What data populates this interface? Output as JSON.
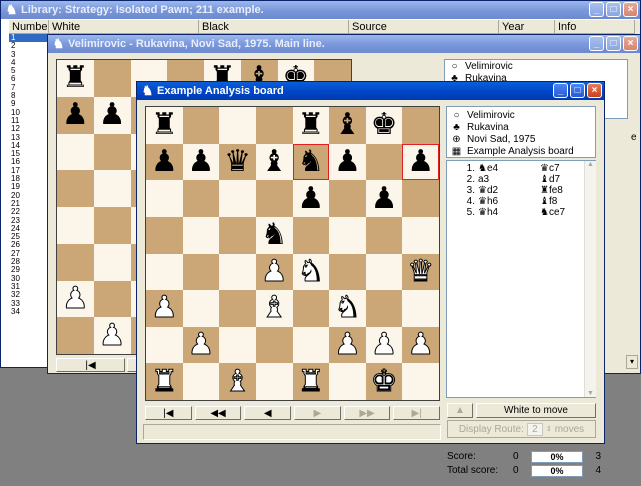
{
  "library": {
    "title": "Library: Strategy: Isolated Pawn; 211 example.",
    "columns": [
      "Number",
      "White",
      "Black",
      "Source",
      "Year",
      "Info"
    ],
    "row_numbers": [
      "1",
      "2",
      "3",
      "4",
      "5",
      "6",
      "7",
      "8",
      "9",
      "10",
      "11",
      "12",
      "13",
      "14",
      "15",
      "16",
      "17",
      "18",
      "19",
      "20",
      "21",
      "22",
      "23",
      "24",
      "25",
      "26",
      "27",
      "28",
      "29",
      "30",
      "31",
      "32",
      "33",
      "34"
    ],
    "selected_row": 1,
    "score": {
      "label": "Score:",
      "value": "0",
      "percent": "0%",
      "count": "3"
    },
    "total_score": {
      "label": "Total score:",
      "value": "0",
      "percent": "0%",
      "count": "4"
    }
  },
  "game_window": {
    "title": "Velimirovic - Rukavina, Novi Sad, 1975. Main line.",
    "header": {
      "white": "Velimirovic",
      "black": "Rukavina"
    },
    "side_letter": "e",
    "board": [
      [
        "bR",
        "",
        "",
        "",
        "bR",
        "bB",
        "bK",
        ""
      ],
      [
        "bP",
        "bP",
        "",
        "",
        "",
        "",
        "",
        ""
      ],
      [
        "",
        "",
        "",
        "",
        "",
        "",
        "",
        ""
      ],
      [
        "",
        "",
        "",
        "",
        "",
        "",
        "",
        ""
      ],
      [
        "",
        "",
        "",
        "",
        "",
        "",
        "",
        ""
      ],
      [
        "",
        "",
        "",
        "",
        "",
        "",
        "",
        ""
      ],
      [
        "wP",
        "",
        "",
        "",
        "",
        "",
        "",
        ""
      ],
      [
        "",
        "wP",
        "",
        "",
        "",
        "",
        "",
        ""
      ]
    ],
    "nav": [
      "|◀",
      "◀◀"
    ]
  },
  "analysis": {
    "title": "Example Analysis board",
    "header": {
      "white": "Velimirovic",
      "black": "Rukavina",
      "event": "Novi Sad, 1975",
      "annotation": "Example Analysis board"
    },
    "board": [
      [
        "bR",
        "",
        "",
        "",
        "bR",
        "bB",
        "bK",
        ""
      ],
      [
        "bP",
        "bP",
        "bQ",
        "bB",
        "bN",
        "bP",
        "",
        "bP"
      ],
      [
        "",
        "",
        "",
        "",
        "bP",
        "",
        "bP",
        ""
      ],
      [
        "",
        "",
        "",
        "bN",
        "",
        "",
        "",
        ""
      ],
      [
        "",
        "",
        "",
        "wP",
        "wN",
        "",
        "",
        "wQ"
      ],
      [
        "wP",
        "",
        "",
        "wB",
        "",
        "wN",
        "",
        ""
      ],
      [
        "",
        "wP",
        "",
        "",
        "",
        "wP",
        "wP",
        "wP"
      ],
      [
        "wR",
        "",
        "wB",
        "",
        "wR",
        "",
        "wK",
        ""
      ]
    ],
    "highlights": [
      [
        1,
        4
      ],
      [
        1,
        7
      ]
    ],
    "nav": [
      "|◀",
      "◀◀",
      "◀",
      "▶",
      "▶▶",
      "▶|"
    ],
    "moves": [
      {
        "num": "1.",
        "white": "♞e4",
        "black": "♛c7"
      },
      {
        "num": "2.",
        "white": "a3",
        "black": "♝d7"
      },
      {
        "num": "3.",
        "white": "♛d2",
        "black": "♜fe8"
      },
      {
        "num": "4.",
        "white": "♛h6",
        "black": "♝f8"
      },
      {
        "num": "5.",
        "white": "♛h4",
        "black": "♞ce7"
      }
    ],
    "white_to_move": "White to move",
    "display_route_label": "Display Route:",
    "route_value": "2",
    "moves_label": "moves"
  },
  "colors": {
    "light_square": "#fbf6e9",
    "dark_square": "#cba676",
    "title_active": "#0047c8",
    "highlight": "#e02020"
  }
}
